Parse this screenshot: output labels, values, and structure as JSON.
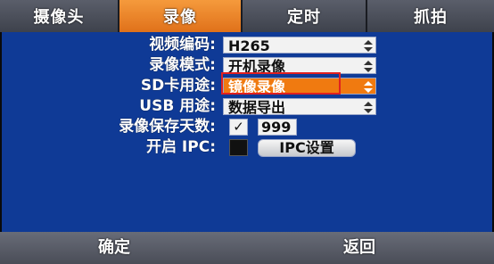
{
  "tabs": [
    {
      "label": "摄像头",
      "active": false
    },
    {
      "label": "录像",
      "active": true
    },
    {
      "label": "定时",
      "active": false
    },
    {
      "label": "抓拍",
      "active": false
    }
  ],
  "settings": {
    "video_encoding": {
      "label": "视频编码:",
      "value": "H265"
    },
    "record_mode": {
      "label": "录像模式:",
      "value": "开机录像"
    },
    "sd_usage": {
      "label": "SD卡用途:",
      "value": "镜像录像"
    },
    "usb_usage": {
      "label": "USB 用途:",
      "value": "数据导出"
    },
    "retention_days": {
      "label": "录像保存天数:",
      "checked": true,
      "value": "999"
    },
    "ipc": {
      "label": "开启 IPC:",
      "checked": false,
      "button_label": "IPC设置"
    }
  },
  "footer": {
    "confirm_label": "确定",
    "back_label": "返回"
  },
  "colors": {
    "panel_bg": "#0f3a96",
    "accent": "#f07a10",
    "highlight": "#e02020"
  },
  "icons": {
    "select_arrow": "up-down-arrow-icon",
    "checkmark": "check-icon"
  },
  "checkmark_glyph": "✓"
}
